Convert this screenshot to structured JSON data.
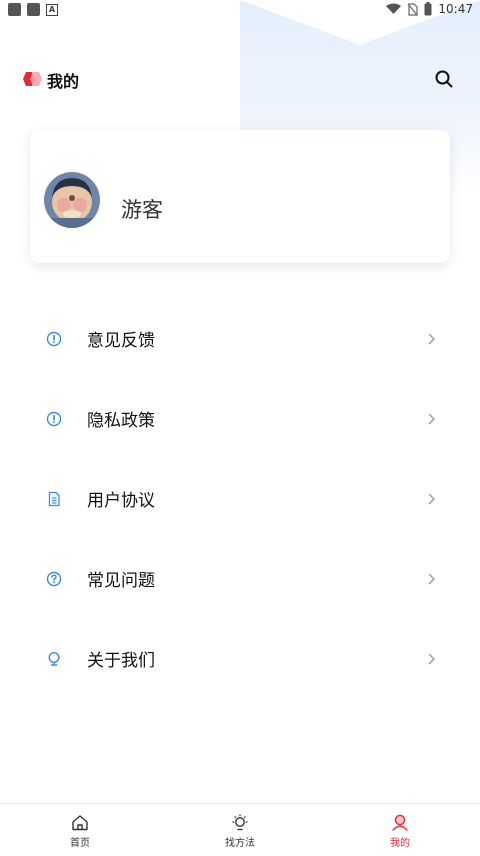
{
  "status_bar": {
    "time": "10:47"
  },
  "header": {
    "title": "我的"
  },
  "profile": {
    "username": "游客"
  },
  "menu": [
    {
      "label": "意见反馈",
      "icon": "info-circle-icon"
    },
    {
      "label": "隐私政策",
      "icon": "info-circle-icon"
    },
    {
      "label": "用户协议",
      "icon": "document-icon"
    },
    {
      "label": "常见问题",
      "icon": "question-circle-icon"
    },
    {
      "label": "关于我们",
      "icon": "bulb-icon"
    }
  ],
  "tabbar": [
    {
      "label": "首页",
      "icon": "home-icon"
    },
    {
      "label": "找方法",
      "icon": "lightbulb-icon"
    },
    {
      "label": "我的",
      "icon": "profile-icon",
      "active": true
    }
  ],
  "colors": {
    "accent": "#e02b3a",
    "icon_blue": "#3f8ad8",
    "bg_tint": "#e4eefc"
  }
}
